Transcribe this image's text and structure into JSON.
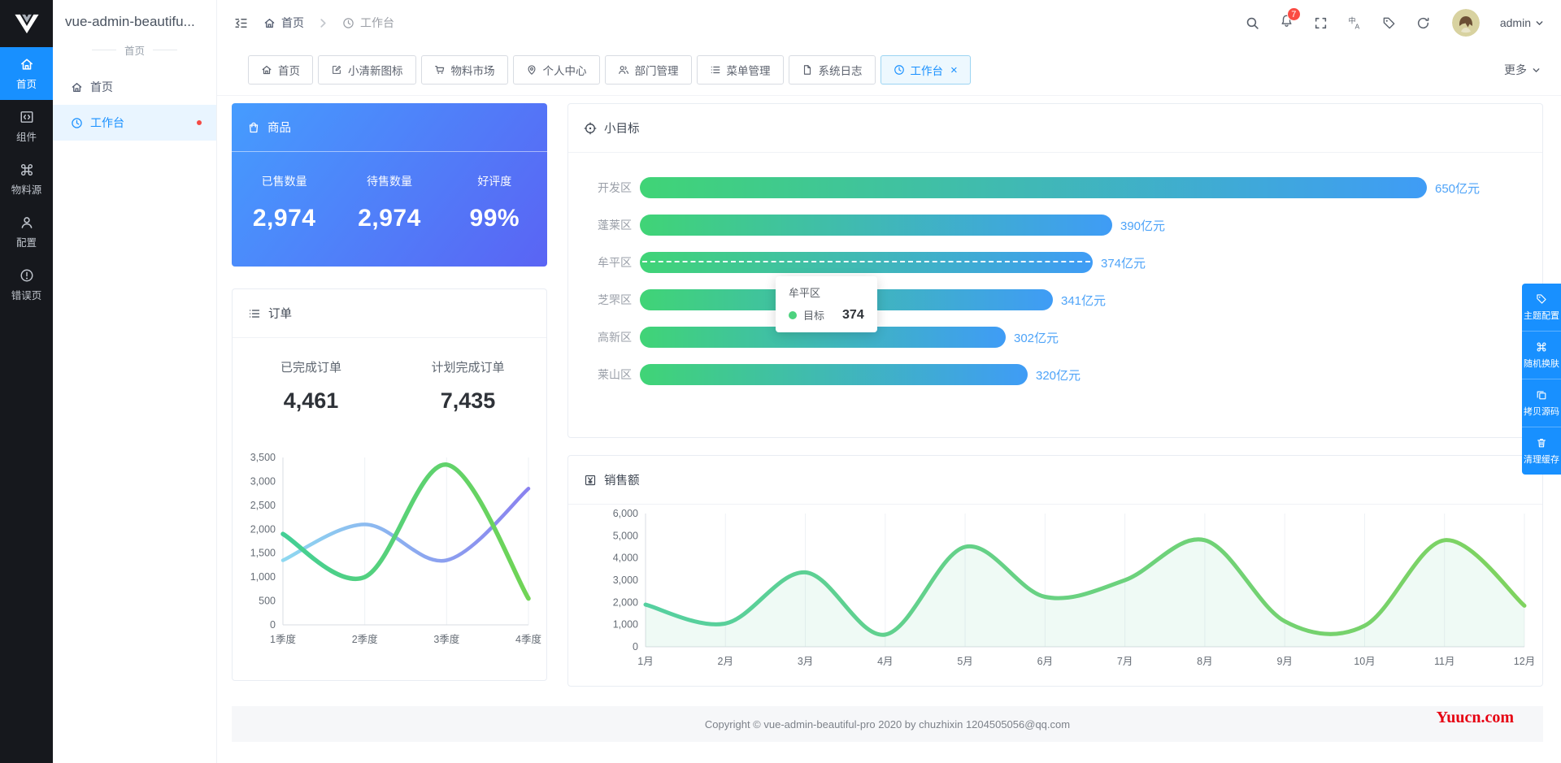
{
  "app": {
    "accent_color": "#1890ff",
    "watermark": "Yuucn.com"
  },
  "sidebar": {
    "items": [
      {
        "label": "首页",
        "icon": "home",
        "active": true
      },
      {
        "label": "组件",
        "icon": "component",
        "active": false
      },
      {
        "label": "物料源",
        "icon": "command",
        "active": false
      },
      {
        "label": "配置",
        "icon": "user",
        "active": false
      },
      {
        "label": "错误页",
        "icon": "error",
        "active": false
      }
    ]
  },
  "submenu": {
    "title": "vue-admin-beautifu...",
    "group_label": "首页",
    "items": [
      {
        "label": "首页",
        "icon": "home",
        "active": false,
        "badge": false
      },
      {
        "label": "工作台",
        "icon": "clock",
        "active": true,
        "badge": true
      }
    ]
  },
  "navbar": {
    "breadcrumb": [
      {
        "label": "首页",
        "icon": "home"
      },
      {
        "label": "工作台",
        "icon": "clock"
      }
    ],
    "notification_count": "7",
    "username": "admin"
  },
  "tabbar": {
    "more_label": "更多",
    "tabs": [
      {
        "label": "首页",
        "icon": "home",
        "active": false,
        "closable": false
      },
      {
        "label": "小清新图标",
        "icon": "pen",
        "active": false,
        "closable": false
      },
      {
        "label": "物料市场",
        "icon": "cart",
        "active": false,
        "closable": false
      },
      {
        "label": "个人中心",
        "icon": "pin",
        "active": false,
        "closable": false
      },
      {
        "label": "部门管理",
        "icon": "people",
        "active": false,
        "closable": false
      },
      {
        "label": "菜单管理",
        "icon": "list",
        "active": false,
        "closable": false
      },
      {
        "label": "系统日志",
        "icon": "doc",
        "active": false,
        "closable": false
      },
      {
        "label": "工作台",
        "icon": "clock",
        "active": true,
        "closable": true
      }
    ]
  },
  "goods": {
    "title": "商品",
    "icon": "bag",
    "stats": [
      {
        "label": "已售数量",
        "value": "2,974"
      },
      {
        "label": "待售数量",
        "value": "2,974"
      },
      {
        "label": "好评度",
        "value": "99%"
      }
    ]
  },
  "orders": {
    "title": "订单",
    "icon": "list",
    "stats": [
      {
        "label": "已完成订单",
        "value": "4,461"
      },
      {
        "label": "计划完成订单",
        "value": "7,435"
      }
    ]
  },
  "goal": {
    "title": "小目标",
    "icon": "target",
    "tooltip": {
      "title": "牟平区",
      "series": "目标",
      "value": "374"
    }
  },
  "sales": {
    "title": "销售额",
    "icon": "yen"
  },
  "tools": [
    {
      "label": "主题配置",
      "icon": "tag"
    },
    {
      "label": "随机换肤",
      "icon": "command"
    },
    {
      "label": "拷贝源码",
      "icon": "copy"
    },
    {
      "label": "清理缓存",
      "icon": "trash"
    }
  ],
  "footer": {
    "text": "Copyright © vue-admin-beautiful-pro 2020 by chuzhixin 1204505056@qq.com"
  },
  "chart_data": [
    {
      "id": "goal",
      "type": "bar",
      "orientation": "horizontal",
      "title": "小目标",
      "categories": [
        "开发区",
        "蓬莱区",
        "牟平区",
        "芝罘区",
        "高新区",
        "莱山区"
      ],
      "values": [
        650,
        390,
        374,
        341,
        302,
        320
      ],
      "value_suffix": "亿元",
      "xlim": [
        0,
        650
      ],
      "series_name": "目标",
      "emphasis_category": "牟平区",
      "bar_colors": [
        "#40d476",
        "#3f9cf6"
      ]
    },
    {
      "id": "orders",
      "type": "line",
      "title": "订单",
      "categories": [
        "1季度",
        "2季度",
        "3季度",
        "4季度"
      ],
      "series": [
        {
          "name": "",
          "values": [
            1350,
            2100,
            1350,
            2850
          ],
          "colors": [
            "#8ed8f0",
            "#8a82ef"
          ]
        },
        {
          "name": "",
          "values": [
            1900,
            1000,
            3350,
            550
          ],
          "colors": [
            "#43cf96",
            "#70d455"
          ]
        }
      ],
      "ylim": [
        0,
        3500
      ],
      "ytick_step": 500,
      "grid": "vertical",
      "legend": "none"
    },
    {
      "id": "sales",
      "type": "line",
      "title": "销售额",
      "categories": [
        "1月",
        "2月",
        "3月",
        "4月",
        "5月",
        "6月",
        "7月",
        "8月",
        "9月",
        "10月",
        "11月",
        "12月"
      ],
      "values": [
        1900,
        1050,
        3350,
        550,
        4500,
        2250,
        3000,
        4800,
        1150,
        950,
        4800,
        1850
      ],
      "ylim": [
        0,
        6000
      ],
      "ytick_step": 1000,
      "grid": "vertical",
      "legend": "none",
      "line_colors": [
        "#55d0a0",
        "#7fd35f"
      ]
    }
  ]
}
